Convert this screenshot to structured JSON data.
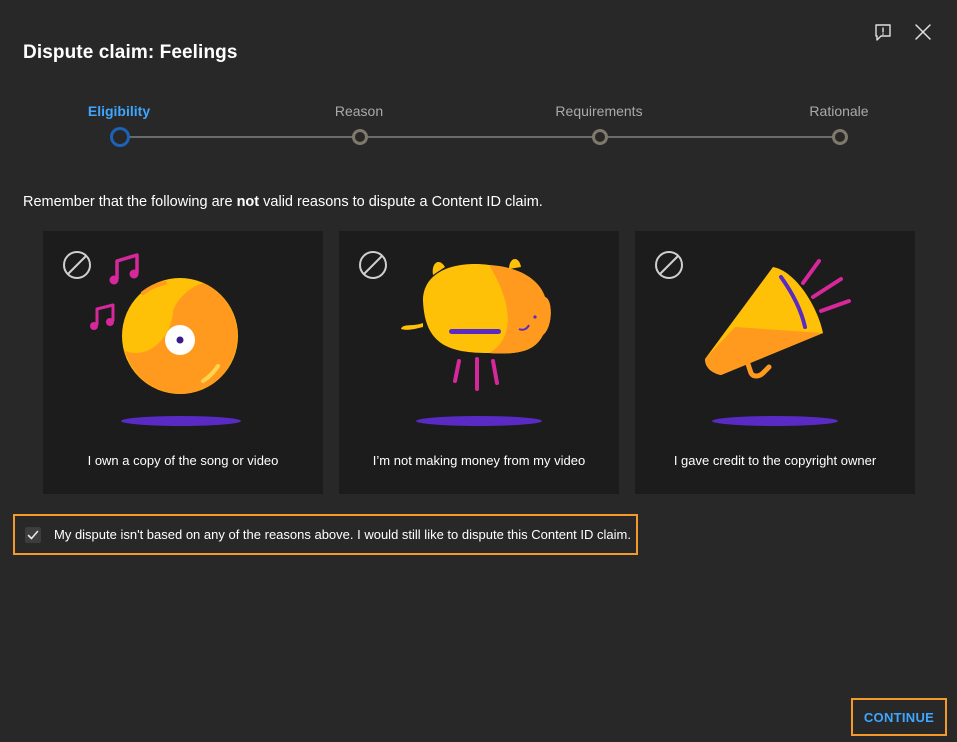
{
  "dialog": {
    "title": "Dispute claim: Feelings",
    "icons": {
      "feedback": "feedback-icon",
      "close": "close-icon"
    }
  },
  "stepper": {
    "steps": [
      {
        "label": "Eligibility",
        "state": "active"
      },
      {
        "label": "Reason",
        "state": "inactive"
      },
      {
        "label": "Requirements",
        "state": "inactive"
      },
      {
        "label": "Rationale",
        "state": "inactive"
      }
    ]
  },
  "notice": {
    "before": "Remember that the following are ",
    "emphasis": "not",
    "after": " valid reasons to dispute a Content ID claim."
  },
  "cards": [
    {
      "icon": "ban-icon",
      "illustration": "vinyl-record-music-notes",
      "caption": "I own a copy of the song or video"
    },
    {
      "icon": "ban-icon",
      "illustration": "piggy-bank",
      "caption": "I’m not making money from my video"
    },
    {
      "icon": "ban-icon",
      "illustration": "megaphone",
      "caption": "I gave credit to the copyright owner"
    }
  ],
  "confirm": {
    "checked": true,
    "label": "My dispute isn't based on any of the reasons above. I would still like to dispute this Content ID claim."
  },
  "actions": {
    "continue_label": "CONTINUE"
  },
  "colors": {
    "background": "#282828",
    "card": "#1c1c1c",
    "accent_blue": "#3ea6ff",
    "highlight_orange": "#f49a2a",
    "illustration_yellow": "#ffc107",
    "illustration_orange": "#ff9a1f",
    "illustration_magenta": "#d6289b",
    "illustration_purple": "#5a2bc4"
  }
}
